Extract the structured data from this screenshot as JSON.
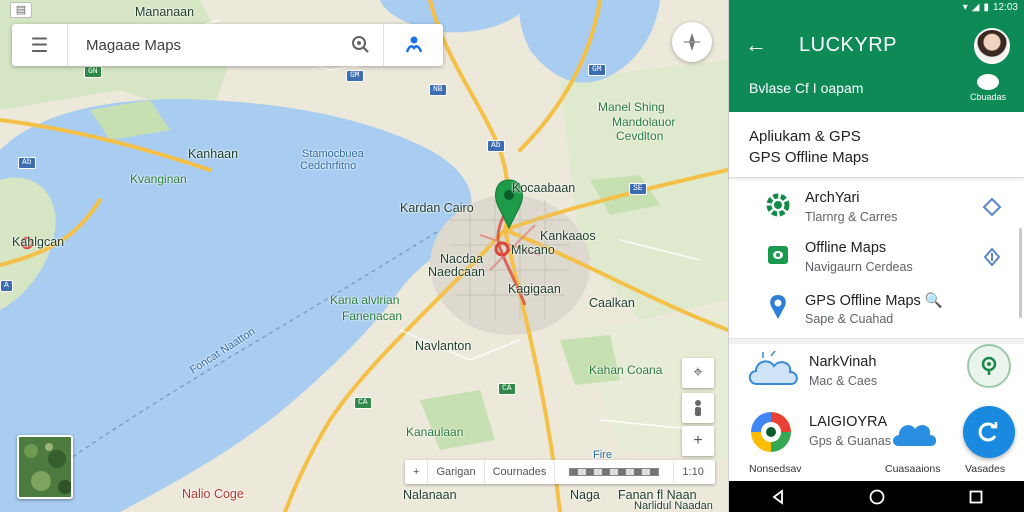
{
  "map": {
    "top_left_icon": "▤",
    "search": {
      "text": "Magaae Maps"
    },
    "labels": {
      "top": "Mananaan",
      "right_upper_1": "Manel Shing",
      "right_upper_2": "Mandolauor",
      "right_upper_3": "Cevdlton",
      "kanhaan": "Kanhaan",
      "kvanginan": "Kvanginan",
      "kocaabaan": "Kocaabaan",
      "kahlgcan": "Kahlgcan",
      "water_1": "Stamocbuea",
      "water_2": "Cedchrfitno",
      "kardan_cairo": "Kardan Cairo",
      "kankaaos": "Kankaaos",
      "mkcano": "Mkcano",
      "nacdaa": "Nacdaa",
      "naedcaan": "Naedcaan",
      "kagigaan": "Kagigaan",
      "karia_1": "Karia alvlrian",
      "karia_2": "Fanenacan",
      "caalkan": "Caalkan",
      "navlanton": "Navlanton",
      "kahan_coana": "Kahan Coana",
      "water_diag": "Foncat Naatton",
      "kanaulaan": "Kanaulaan",
      "nalio_coge": "Nalio Coge",
      "nalanaan": "Nalanaan",
      "naga": "Naga",
      "bottom_right_1": "Fanan fl Naan",
      "bottom_right_2": "Narlidul Naadan",
      "fire": "Fire"
    },
    "shields": [
      "GN",
      "GM",
      "NB",
      "GM",
      "Ab",
      "Ab",
      "SE",
      "CA",
      "CA",
      "Aa",
      "CA",
      "EC",
      "CA",
      "CA",
      "AB",
      "CA",
      "BA",
      "AB",
      "A"
    ],
    "toolbar": {
      "add": "+",
      "btn1": "Garigan",
      "btn2": "Cournades",
      "zoom": "1:10"
    },
    "controls": {
      "locate": "⌖",
      "zoom_in": "+"
    }
  },
  "panel": {
    "status": {
      "time": "12:03"
    },
    "header": {
      "title": "LUCKYRP",
      "subtitle": "Bvlase Cf I oapam",
      "action_label": "Cbuadas"
    },
    "app_info": {
      "line1": "Apliukam & GPS",
      "line2": "GPS Offline Maps"
    },
    "items": [
      {
        "title": "ArchYari",
        "sub": "Tlarnrg & Carres"
      },
      {
        "title": "Offline Maps",
        "sub": "Navigaurn Cerdeas"
      },
      {
        "title": "GPS Offline Maps 🔍",
        "sub": "Sape & Cuahad"
      }
    ],
    "cards": [
      {
        "title": "NarkVinah",
        "sub": "Mac & Caes"
      },
      {
        "title": "LAIGIOYRA",
        "sub": "Gps & Guanas"
      }
    ],
    "footer": {
      "left": "Nonsedsav",
      "middle": "Cuasaaions",
      "right": "Vasades"
    }
  },
  "colors": {
    "accent": "#0e8a57",
    "fab_blue": "#1a8ae0",
    "water": "#a8cdf0",
    "road": "#f4c048"
  }
}
